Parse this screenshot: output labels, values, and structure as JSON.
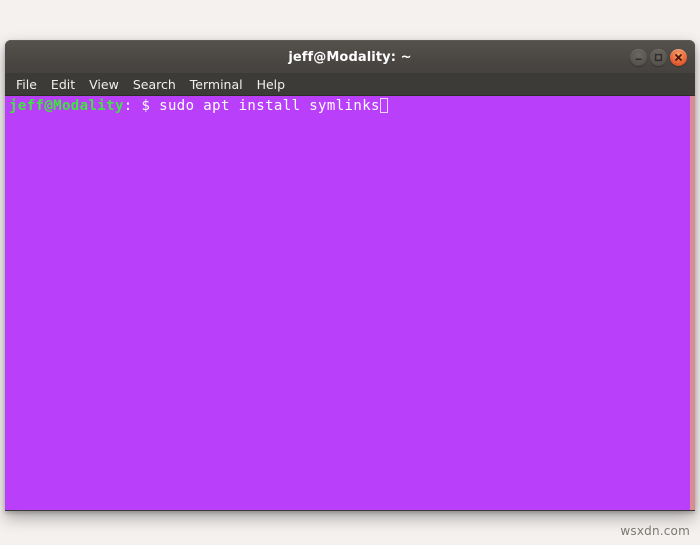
{
  "page": {
    "background_color": "#f4f1ef",
    "watermark": "wsxdn.com"
  },
  "window": {
    "title": "jeff@Modality: ~",
    "titlebar_color": "#4b4743",
    "controls": [
      {
        "name": "minimize",
        "glyph": "minimize-icon",
        "color": "#59554f"
      },
      {
        "name": "maximize",
        "glyph": "maximize-icon",
        "color": "#59554f"
      },
      {
        "name": "close",
        "glyph": "close-icon",
        "color": "#e8663a"
      }
    ]
  },
  "menubar": {
    "background_color": "#3c3b37",
    "items": [
      {
        "label": "File"
      },
      {
        "label": "Edit"
      },
      {
        "label": "View"
      },
      {
        "label": "Search"
      },
      {
        "label": "Terminal"
      },
      {
        "label": "Help"
      }
    ]
  },
  "terminal": {
    "background_color": "#b93ffb",
    "foreground_color": "#ffffff",
    "prompt_user_color": "#3ee63e",
    "prompt_path_color": "#6a8cff",
    "scrollbar_color": "#d98c93",
    "lines": [
      {
        "prompt_user": "jeff@Modality",
        "prompt_colon": ":",
        "prompt_path": " ",
        "prompt_symbol": "$",
        "command": " sudo apt install symlinks",
        "cursor": true
      }
    ]
  }
}
